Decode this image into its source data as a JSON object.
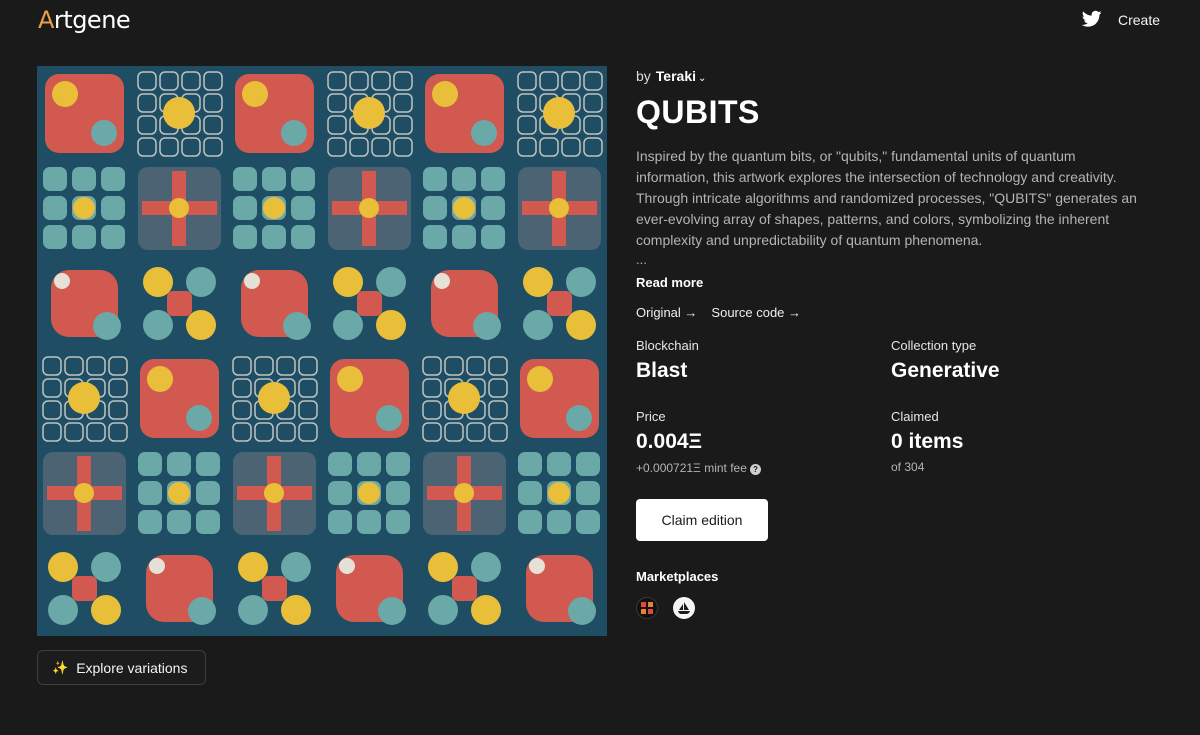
{
  "header": {
    "logo_initial": "A",
    "logo_rest": "rtgene",
    "create_label": "Create",
    "twitter_icon": "twitter-bird-icon"
  },
  "artwork": {
    "explore_label": "Explore variations",
    "explore_icon": "sparkles-icon",
    "palette": {
      "background": "#1f4e64",
      "teal": "#6aa9a8",
      "red": "#d2594f",
      "yellow": "#e9bf3a",
      "cream": "#e6e1d6",
      "slate": "#4c6373"
    }
  },
  "collection": {
    "by_prefix": "by",
    "artist": "Teraki",
    "title": "QUBITS",
    "description": "Inspired by the quantum bits, or \"qubits,\" fundamental units of quantum information, this artwork explores the intersection of technology and creativity. Through intricate algorithms and randomized processes, \"QUBITS\" generates an ever-evolving array of shapes, patterns, and colors, symbolizing the inherent complexity and unpredictability of quantum phenomena.",
    "ellipsis": "...",
    "read_more": "Read more",
    "links": {
      "original": "Original →",
      "source_code": "Source code →"
    },
    "blockchain_label": "Blockchain",
    "blockchain_value": "Blast",
    "collection_type_label": "Collection type",
    "collection_type_value": "Generative",
    "price_label": "Price",
    "price_value": "0.004Ξ",
    "mint_fee": "+0.000721Ξ mint fee",
    "claimed_label": "Claimed",
    "claimed_value": "0 items",
    "claimed_total": "of 304",
    "claim_button": "Claim edition",
    "marketplaces_label": "Marketplaces",
    "marketplaces": [
      "marketplace-a-icon",
      "opensea-icon"
    ]
  }
}
